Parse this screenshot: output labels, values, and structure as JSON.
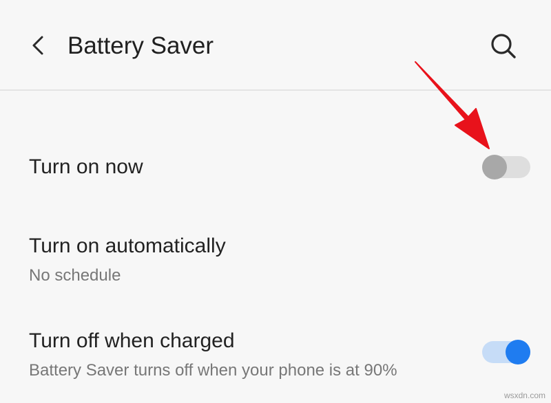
{
  "header": {
    "title": "Battery Saver",
    "back_icon": "back-arrow-icon",
    "search_icon": "search-icon"
  },
  "settings": [
    {
      "title": "Turn on now",
      "subtitle": "",
      "toggle": "off"
    },
    {
      "title": "Turn on automatically",
      "subtitle": "No schedule"
    },
    {
      "title": "Turn off when charged",
      "subtitle": "Battery Saver turns off when your phone is at 90%",
      "toggle": "on"
    }
  ],
  "annotation": {
    "arrow_color": "#e8121b",
    "icon": "red-pointer-arrow-icon"
  },
  "colors": {
    "toggle_on": "#1f7cf0",
    "toggle_on_track": "#c6dcf7",
    "toggle_off_knob": "#a8a8a8",
    "toggle_off_track": "#dedede"
  },
  "watermark": "wsxdn.com"
}
